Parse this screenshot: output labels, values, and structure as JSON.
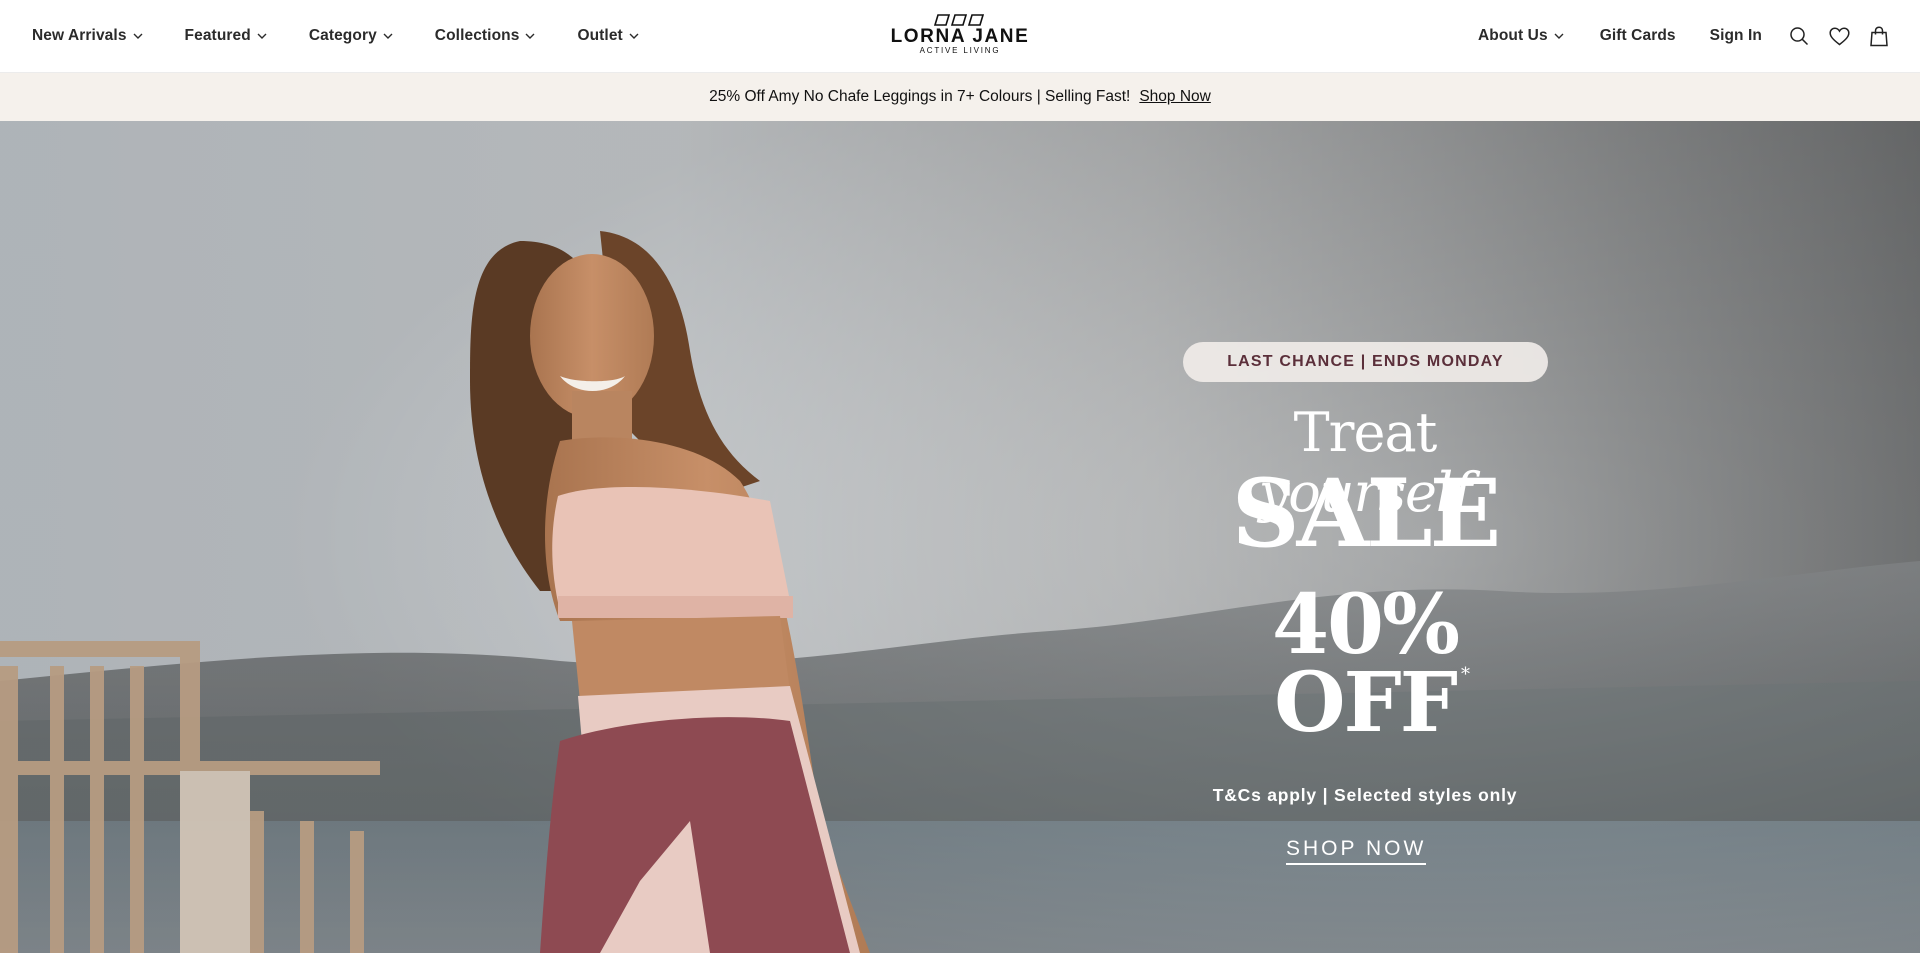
{
  "nav": {
    "left_items": [
      {
        "label": "New Arrivals",
        "icon": "chevron-down-icon"
      },
      {
        "label": "Featured",
        "icon": "chevron-down-icon"
      },
      {
        "label": "Category",
        "icon": "chevron-down-icon"
      },
      {
        "label": "Collections",
        "icon": "chevron-down-icon"
      },
      {
        "label": "Outlet",
        "icon": "chevron-down-icon"
      }
    ],
    "logo": {
      "main": "LORNA JANE",
      "sub": "ACTIVE LIVING"
    },
    "right_items": [
      {
        "label": "About Us",
        "icon": "chevron-down-icon"
      },
      {
        "label": "Gift Cards"
      },
      {
        "label": "Sign In"
      }
    ],
    "icons": [
      "search-icon",
      "heart-icon",
      "shopping-bag-icon"
    ]
  },
  "promo_bar": {
    "text": "25% Off Amy No Chafe Leggings in 7+ Colours | Selling Fast!",
    "link_label": "Shop Now",
    "background": "#f5f1ec"
  },
  "hero": {
    "badge": "LAST CHANCE | ENDS MONDAY",
    "headline_plain": "Treat ",
    "headline_italic": "yourself",
    "sale": "SALE",
    "discount_line1": "40%",
    "discount_line2": "OFF",
    "asterisk": "*",
    "terms": "T&Cs apply | Selected styles only",
    "cta": "SHOP NOW",
    "badge_text_color": "#5b2f3a",
    "image": "woman-in-pink-activewear-beach-photo"
  }
}
